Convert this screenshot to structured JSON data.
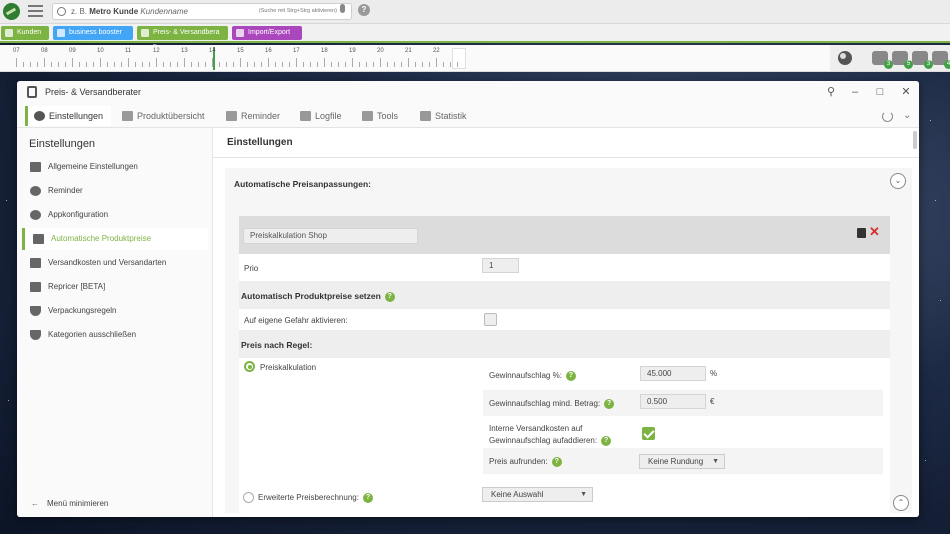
{
  "search": {
    "prefix": "z. B.",
    "example": "Metro Kunde",
    "placeholder_rest": "Kundenname",
    "hint": "(Suche mit Strg+Strg aktivieren)"
  },
  "modules": [
    {
      "label": "Kunden",
      "color": "#7cb342"
    },
    {
      "label": "business booster",
      "color": "#42a5f5"
    },
    {
      "label": "Preis- & Versandbera ▾",
      "color": "#7cb342"
    },
    {
      "label": "Import/Export",
      "color": "#ab47bc"
    }
  ],
  "timeline": {
    "hours": [
      "07",
      "08",
      "09",
      "10",
      "11",
      "12",
      "13",
      "14",
      "15",
      "16",
      "17",
      "18",
      "19",
      "20",
      "21",
      "22"
    ]
  },
  "notification_badges": [
    "3",
    "5",
    "3",
    "4"
  ],
  "window": {
    "title": "Preis- & Versandberater",
    "tabs": [
      {
        "label": "Einstellungen"
      },
      {
        "label": "Produktübersicht"
      },
      {
        "label": "Reminder"
      },
      {
        "label": "Logfile"
      },
      {
        "label": "Tools"
      },
      {
        "label": "Statistik"
      }
    ]
  },
  "sidebar": {
    "title": "Einstellungen",
    "items": [
      {
        "label": "Allgemeine Einstellungen"
      },
      {
        "label": "Reminder"
      },
      {
        "label": "Appkonfiguration"
      },
      {
        "label": "Automatische Produktpreise"
      },
      {
        "label": "Versandkosten und Versandarten"
      },
      {
        "label": "Repricer [BETA]"
      },
      {
        "label": "Verpackungsregeln"
      },
      {
        "label": "Kategorien ausschließen"
      }
    ],
    "minimize_label": "Menü minimieren"
  },
  "main": {
    "title": "Einstellungen",
    "panel_title": "Automatische Preisanpassungen:",
    "rule_name": "Preiskalkulation Shop",
    "prio_label": "Prio",
    "prio_value": "1",
    "auto_section_title": "Automatisch Produktpreise setzen",
    "own_risk_label": "Auf eigene Gefahr aktivieren:",
    "rule_section_title": "Preis nach Regel:",
    "option_preiskalkulation": "Preiskalkulation",
    "markup_pct_label": "Gewinnaufschlag %:",
    "markup_pct_value": "45.000",
    "markup_pct_unit": "%",
    "markup_min_label": "Gewinnaufschlag mind. Betrag:",
    "markup_min_value": "0.500",
    "markup_min_unit": "€",
    "shipping_add_label_1": "Interne Versandkosten auf",
    "shipping_add_label_2": "Gewinnaufschlag aufaddieren:",
    "round_label": "Preis aufrunden:",
    "round_value": "Keine Rundung",
    "option_advanced": "Erweiterte Preisberechnung:",
    "advanced_value": "Keine Auswahl"
  }
}
